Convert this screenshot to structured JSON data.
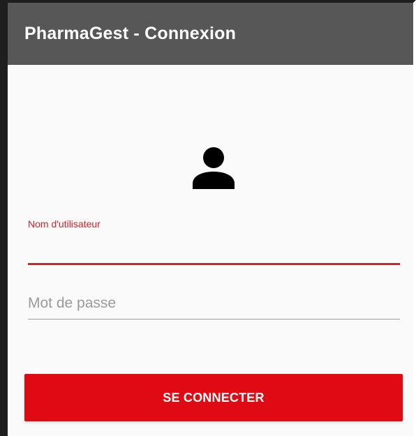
{
  "app": {
    "title": "PharmaGest - Connexion"
  },
  "form": {
    "username": {
      "label": "Nom d'utilisateur",
      "value": ""
    },
    "password": {
      "placeholder": "Mot de passe",
      "value": ""
    },
    "submit_label": "SE CONNECTER"
  },
  "icons": {
    "avatar": "person-icon"
  },
  "colors": {
    "toolbar": "#575757",
    "accent": "#e01b24",
    "button": "#e00b12",
    "background": "#fafafa"
  }
}
